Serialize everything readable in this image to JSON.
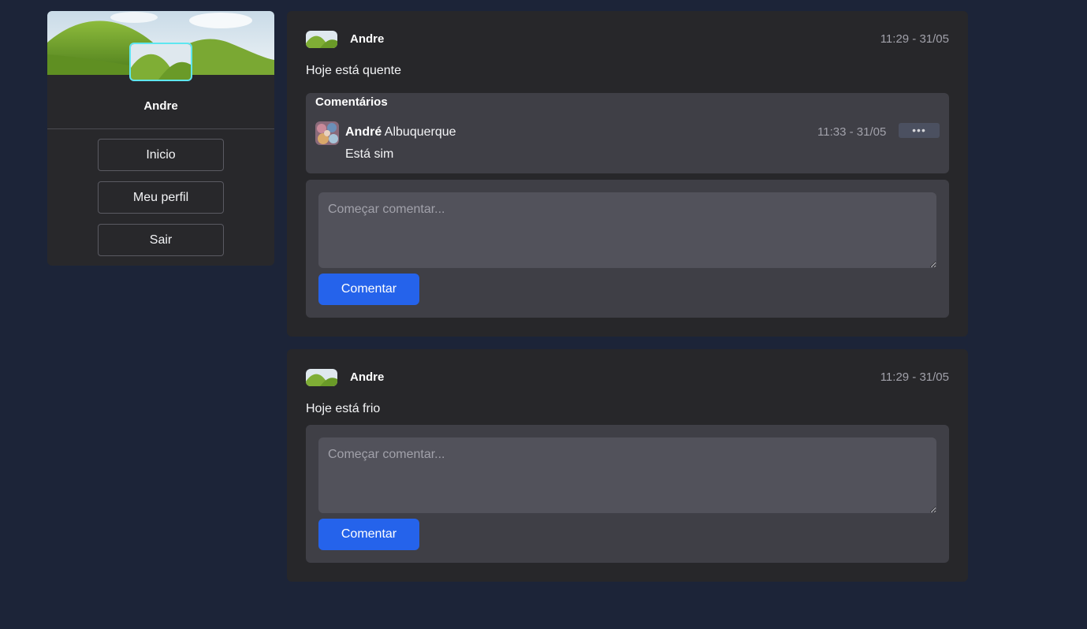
{
  "sidebar": {
    "user_name": "Andre",
    "nav": [
      {
        "label": "Inicio"
      },
      {
        "label": "Meu perfil"
      },
      {
        "label": "Sair"
      }
    ]
  },
  "posts": [
    {
      "author": "Andre",
      "time": "11:29 - 31/05",
      "text": "Hoje está quente",
      "comments_title": "Comentários",
      "comments": [
        {
          "author_first": "André",
          "author_last": "Albuquerque",
          "time": "11:33 - 31/05",
          "text": "Está sim",
          "menu_icon": "•••"
        }
      ],
      "comment_placeholder": "Começar comentar...",
      "submit_label": "Comentar"
    },
    {
      "author": "Andre",
      "time": "11:29 - 31/05",
      "text": "Hoje está frio",
      "comment_placeholder": "Começar comentar...",
      "submit_label": "Comentar"
    }
  ],
  "colors": {
    "page_bg": "#1c2438",
    "panel_bg": "#27272a",
    "inner_bg": "#3f3f46",
    "accent": "#2563eb",
    "avatar_border": "#5ee6f0"
  }
}
